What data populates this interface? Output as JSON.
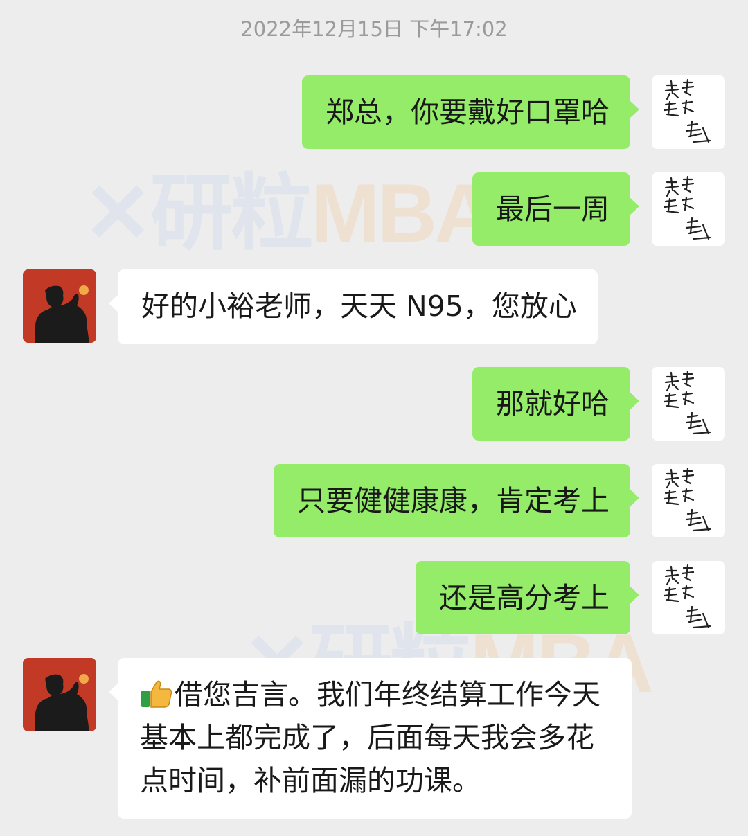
{
  "timestamp": "2022年12月15日 下午17:02",
  "watermark": {
    "brand": "研粒",
    "suffix": "MBA"
  },
  "messages": [
    {
      "sender": "me",
      "text": "郑总，你要戴好口罩哈"
    },
    {
      "sender": "me",
      "text": "最后一周"
    },
    {
      "sender": "other",
      "text": "好的小裕老师，天天 N95，您放心"
    },
    {
      "sender": "me",
      "text": "那就好哈"
    },
    {
      "sender": "me",
      "text": "只要健健康康，肯定考上"
    },
    {
      "sender": "me",
      "text": "还是高分考上"
    },
    {
      "sender": "other",
      "emoji": "thumbs-up",
      "text": "借您吉言。我们年终结算工作今天基本上都完成了，后面每天我会多花点时间，补前面漏的功课。"
    }
  ],
  "colors": {
    "background": "#ededed",
    "outgoing_bubble": "#95ec69",
    "incoming_bubble": "#ffffff",
    "timestamp": "#9b9b9b",
    "avatar_red": "#c23a26"
  }
}
